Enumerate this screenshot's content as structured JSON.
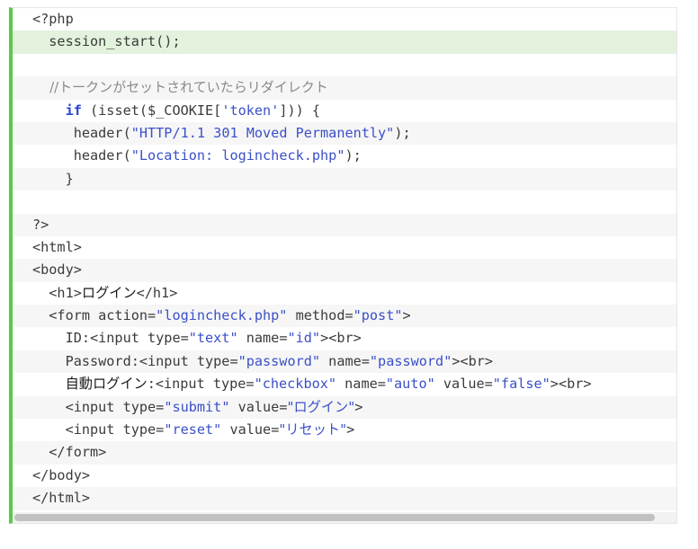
{
  "code": {
    "lines": [
      [
        "<?php"
      ],
      [
        "  session_start();"
      ],
      [
        ""
      ],
      [
        "    //トークンがセットされていたらリダイレクト"
      ],
      [
        "    ",
        "if",
        " (isset($_COOKIE[",
        "'token'",
        "])) {"
      ],
      [
        "     header(",
        "\"HTTP/1.1 301 Moved Permanently\"",
        ");"
      ],
      [
        "     header(",
        "\"Location: logincheck.php\"",
        ");"
      ],
      [
        "    }"
      ],
      [
        ""
      ],
      [
        "?>"
      ],
      [
        "<html>"
      ],
      [
        "<body>"
      ],
      [
        "  <h1>",
        "ログイン",
        "</h1>"
      ],
      [
        "  <form action=",
        "\"logincheck.php\"",
        " method=",
        "\"post\"",
        ">"
      ],
      [
        "    ID:<input type=",
        "\"text\"",
        " name=",
        "\"id\"",
        "><br>"
      ],
      [
        "    Password:<input type=",
        "\"password\"",
        " name=",
        "\"password\"",
        "><br>"
      ],
      [
        "    ",
        "自動ログイン",
        ":<input type=",
        "\"checkbox\"",
        " name=",
        "\"auto\"",
        " value=",
        "\"false\"",
        "><br>"
      ],
      [
        "    <input type=",
        "\"submit\"",
        " value=",
        "\"ログイン\"",
        ">"
      ],
      [
        "    <input type=",
        "\"reset\"",
        " value=",
        "\"リセット\"",
        ">"
      ],
      [
        "  </form>"
      ],
      [
        "</body>"
      ],
      [
        "</html>"
      ]
    ]
  },
  "colors": {
    "accent_border": "#5ac84a",
    "highlight_line": "#e2f2dc",
    "string": "#3b50c8",
    "keyword": "#2b44d6",
    "comment": "#8a8a8a"
  },
  "scrollbar": {
    "horizontal": true
  }
}
